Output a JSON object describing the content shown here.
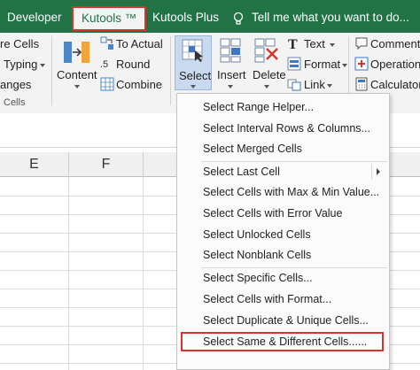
{
  "tabs": {
    "developer": "Developer",
    "kutools": "Kutools ™",
    "kutools_plus": "Kutools Plus",
    "tell_me": "Tell me what you want to do..."
  },
  "ribbon": {
    "left_group": {
      "row1": "re Cells",
      "row2": "Typing",
      "row3": "anges",
      "group_label": "Cells"
    },
    "convert_group": {
      "to_actual": "To Actual",
      "round": "Round",
      "combine": "Combine",
      "content": "Content"
    },
    "editing_group": {
      "select": "Select",
      "insert": "Insert",
      "delete": "Delete"
    },
    "format_group": {
      "text": "Text",
      "format": "Format",
      "link": "Link"
    },
    "right_group": {
      "comment": "Comment",
      "operation": "Operation",
      "calculator": "Calculator"
    }
  },
  "columns": [
    "E",
    "F"
  ],
  "menu": {
    "items": [
      "Select Range Helper...",
      "Select Interval Rows & Columns...",
      "Select Merged Cells",
      "Select Last Cell",
      "Select Cells with Max & Min Value...",
      "Select Cells with Error Value",
      "Select Unlocked Cells",
      "Select Nonblank Cells",
      "Select Specific Cells...",
      "Select Cells with Format...",
      "Select Duplicate & Unique Cells...",
      "Select Same & Different Cells......"
    ],
    "highlighted_item": "Select Same & Different Cells......"
  },
  "colors": {
    "ribbon_green": "#217346",
    "highlight_red": "#d9342b",
    "select_button_bg": "#c9d9ef"
  }
}
